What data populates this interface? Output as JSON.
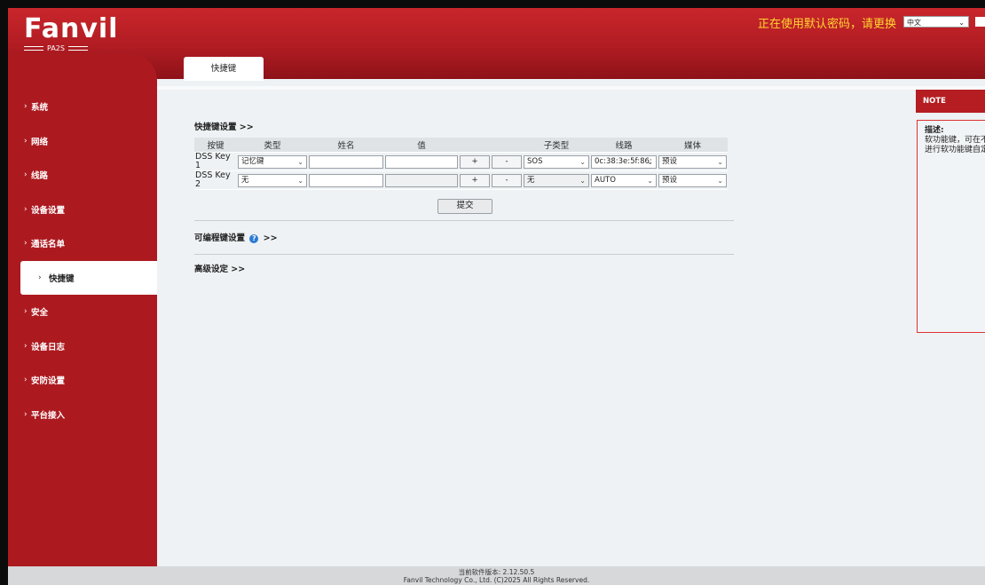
{
  "header": {
    "logo_text": "Fanvil",
    "model": "PA2S",
    "warning": "正在使用默认密码，请更换",
    "language": "中文"
  },
  "sidebar": {
    "items": [
      {
        "label": "系统"
      },
      {
        "label": "网络"
      },
      {
        "label": "线路"
      },
      {
        "label": "设备设置"
      },
      {
        "label": "通话名单"
      },
      {
        "label": "快捷键"
      },
      {
        "label": "安全"
      },
      {
        "label": "设备日志"
      },
      {
        "label": "安防设置"
      },
      {
        "label": "平台接入"
      }
    ],
    "active_index": 5
  },
  "tabs": [
    {
      "label": "快捷键"
    }
  ],
  "main": {
    "section_title": "快捷键设置 >>",
    "columns": [
      "按键",
      "类型",
      "姓名",
      "值",
      "",
      "子类型",
      "线路",
      "媒体"
    ],
    "rows": [
      {
        "key": "DSS Key 1",
        "type": "记忆键",
        "name": "",
        "value": "",
        "plus": "+",
        "minus": "-",
        "subtype": "SOS",
        "line": "0c:38:3e:5f:86:",
        "media": "预设",
        "value_disabled": false,
        "subtype_disabled": false
      },
      {
        "key": "DSS Key 2",
        "type": "无",
        "name": "",
        "value": "",
        "plus": "+",
        "minus": "-",
        "subtype": "无",
        "line": "AUTO",
        "media": "预设",
        "value_disabled": true,
        "subtype_disabled": true
      }
    ],
    "submit_label": "提交",
    "programmable_title": "可编程键设置",
    "programmable_suffix": ">>",
    "advanced_title": "高级设定 >>"
  },
  "note": {
    "title": "NOTE",
    "label": "描述:",
    "line1": "软功能键，可在不",
    "line2": "进行软功能键自定"
  },
  "footer": {
    "version": "当前软件版本: 2.12.50.5",
    "copyright": "Fanvil Technology Co., Ltd. (C)2025 All Rights Reserved."
  },
  "colors": {
    "brand_red": "#b01c22",
    "warning_yellow": "#ffd52e",
    "help_blue": "#2d7bd4"
  }
}
